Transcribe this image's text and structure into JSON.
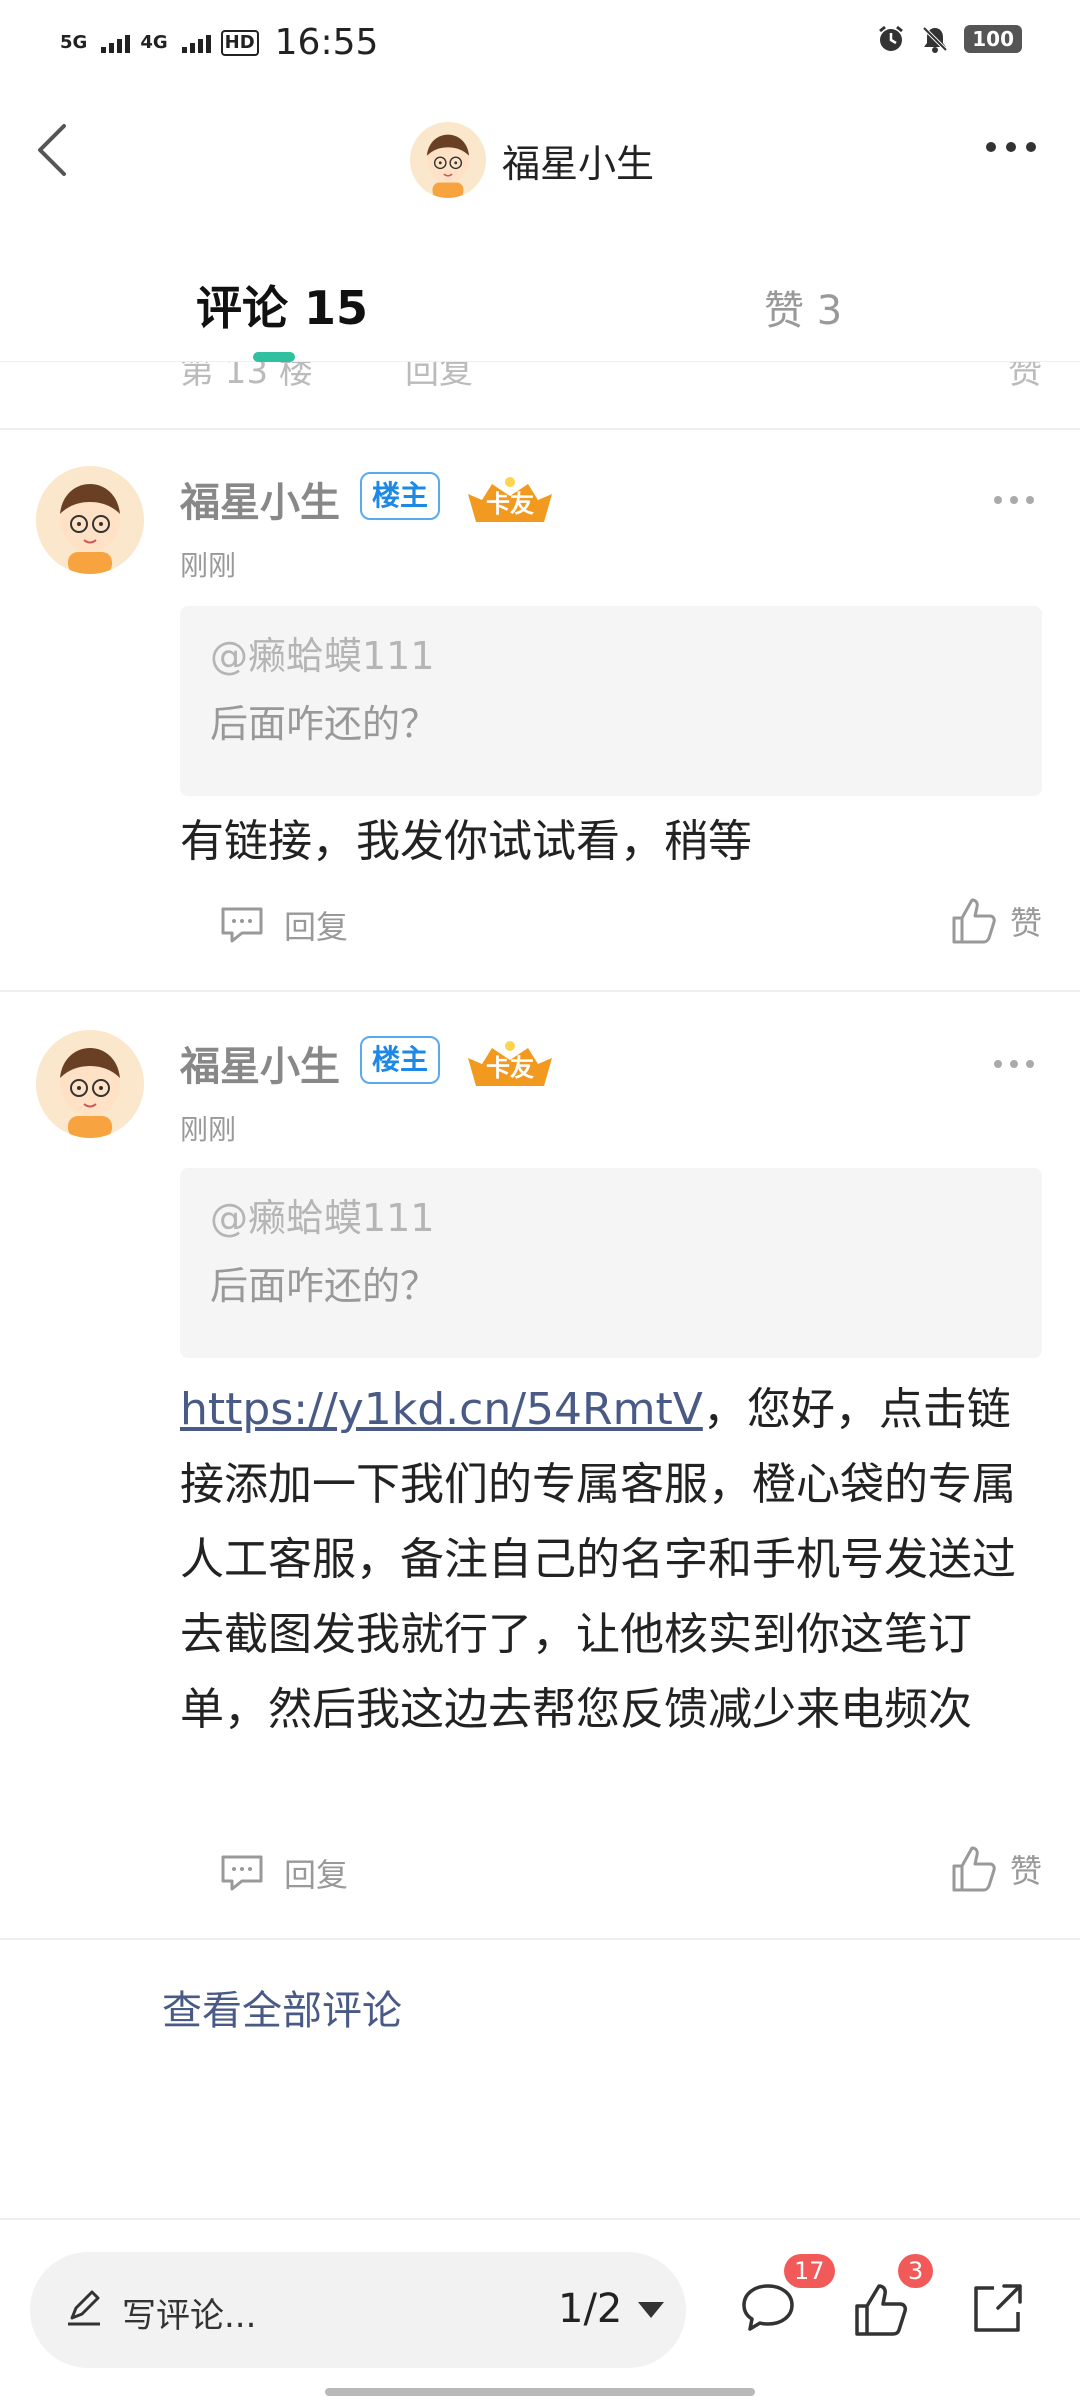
{
  "status_bar": {
    "net1": "5G",
    "net2": "4G",
    "hd": "HD",
    "time": "16:55",
    "battery": "100"
  },
  "header": {
    "username": "福星小生"
  },
  "tabs": {
    "comments_label": "评论 15",
    "likes_label": "赞 3"
  },
  "peek": {
    "floor": "第 13 楼",
    "reply": "回复",
    "like": "赞"
  },
  "comments": [
    {
      "name": "福星小生",
      "owner_badge": "楼主",
      "card_badge": "卡友",
      "time": "刚刚",
      "quote_name": "@癞蛤蟆111",
      "quote_text": "后面咋还的？",
      "body": "有链接，我发你试试看，稍等",
      "reply": "回复",
      "like": "赞"
    },
    {
      "name": "福星小生",
      "owner_badge": "楼主",
      "card_badge": "卡友",
      "time": "刚刚",
      "quote_name": "@癞蛤蟆111",
      "quote_text": "后面咋还的？",
      "link": "https://y1kd.cn/54RmtV",
      "body": "，您好，点击链接添加一下我们的专属客服，橙心袋的专属人工客服，备注自己的名字和手机号发送过去截图发我就行了，让他核实到你这笔订单，然后我这边去帮您反馈减少来电频次",
      "reply": "回复",
      "like": "赞"
    }
  ],
  "view_all": "查看全部评论",
  "bottom_bar": {
    "placeholder": "写评论...",
    "page": "1/2",
    "comment_count": "17",
    "like_count": "3"
  },
  "colors": {
    "accent": "#2fc0a0",
    "link": "#4a5a86",
    "badge_blue": "#1e88e5",
    "red_dot": "#f25a5a"
  },
  "icons": [
    "back-icon",
    "more-icon",
    "comment-icon",
    "thumb-up-icon",
    "share-icon",
    "pen-icon",
    "dropdown-icon",
    "alarm-icon",
    "bell-off-icon"
  ]
}
